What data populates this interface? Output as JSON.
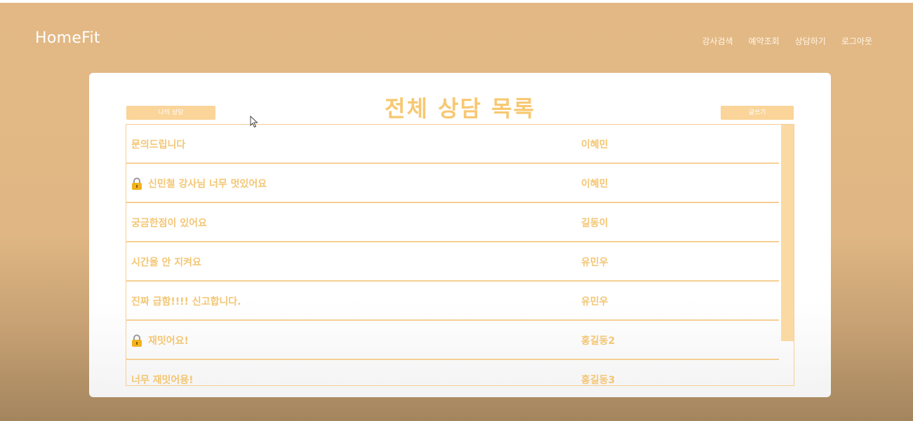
{
  "brand": "HomeFit",
  "nav": [
    "강사검색",
    "예약조회",
    "상담하기",
    "로그아웃"
  ],
  "page_title": "전체 상담 목록",
  "my_consult_button": "나의 상담",
  "write_button": "글쓰기",
  "rows": [
    {
      "title": "문의드립니다",
      "author": "이혜민",
      "locked": false
    },
    {
      "title": "신민철 강사님 너무 멋있어요",
      "author": "이혜민",
      "locked": true
    },
    {
      "title": "궁금한점이 있어요",
      "author": "길동이",
      "locked": false
    },
    {
      "title": "시간을 안 지켜요",
      "author": "유민우",
      "locked": false
    },
    {
      "title": "진짜 급함!!!! 신고합니다.",
      "author": "유민우",
      "locked": false
    },
    {
      "title": "재밋어요!",
      "author": "홍길동2",
      "locked": true
    },
    {
      "title": "너무 재밋어용!",
      "author": "홍길동3",
      "locked": false
    }
  ],
  "icons": {
    "lock": "lock-icon",
    "cursor": "mouse-pointer-icon"
  },
  "colors": {
    "accent": "#f4c674",
    "background": "#e3b885"
  }
}
